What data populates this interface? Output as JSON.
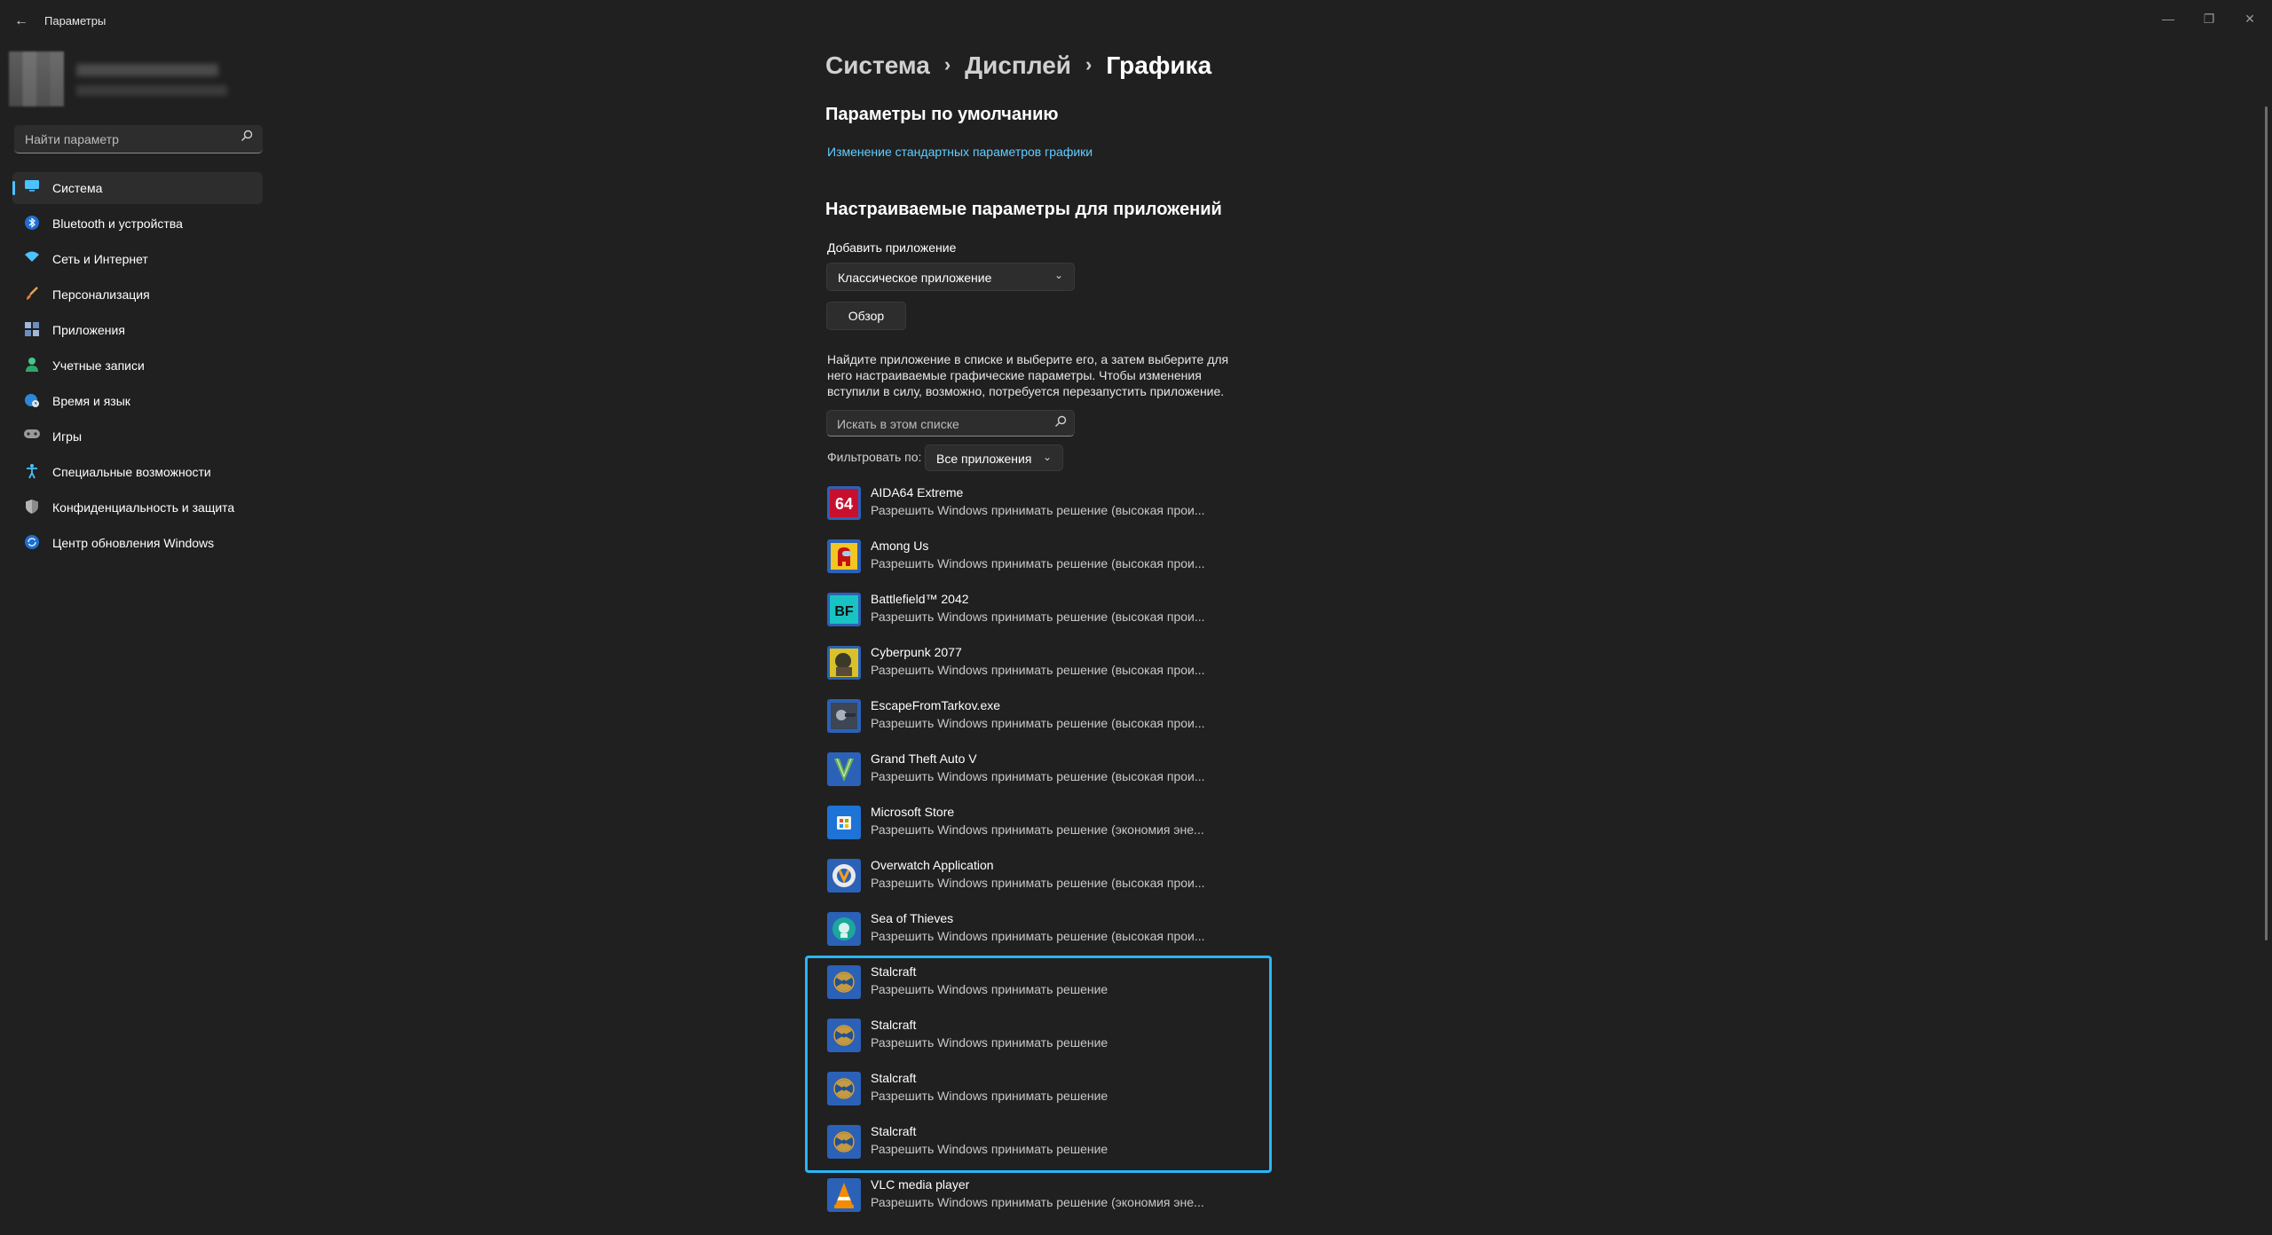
{
  "window": {
    "title": "Параметры",
    "controls": [
      "minimize",
      "restore",
      "close"
    ]
  },
  "sidebar": {
    "search": {
      "placeholder": "Найти параметр",
      "icon": "search-icon"
    },
    "items": [
      {
        "label": "Система",
        "icon": "monitor-icon",
        "color": "#4cc2ff",
        "active": true
      },
      {
        "label": "Bluetooth и устройства",
        "icon": "bluetooth-icon",
        "color": "#4cc2ff"
      },
      {
        "label": "Сеть и Интернет",
        "icon": "wifi-icon",
        "color": "#4cc2ff"
      },
      {
        "label": "Персонализация",
        "icon": "brush-icon",
        "color": "#f0a04b"
      },
      {
        "label": "Приложения",
        "icon": "apps-icon",
        "color": "#7fa6d9"
      },
      {
        "label": "Учетные записи",
        "icon": "person-icon",
        "color": "#42c88a"
      },
      {
        "label": "Время и язык",
        "icon": "globe-clock-icon",
        "color": "#4cc2ff"
      },
      {
        "label": "Игры",
        "icon": "gamepad-icon",
        "color": "#bdbdbd"
      },
      {
        "label": "Специальные возможности",
        "icon": "accessibility-icon",
        "color": "#4cc2ff"
      },
      {
        "label": "Конфиденциальность и защита",
        "icon": "shield-icon",
        "color": "#9a9a9a"
      },
      {
        "label": "Центр обновления Windows",
        "icon": "update-icon",
        "color": "#4cc2ff"
      }
    ]
  },
  "breadcrumb": {
    "items": [
      "Система",
      "Дисплей"
    ],
    "current": "Графика",
    "separator": "›"
  },
  "defaults": {
    "heading": "Параметры по умолчанию",
    "link": "Изменение стандартных параметров графики"
  },
  "custom": {
    "heading": "Настраиваемые параметры для приложений",
    "add_label": "Добавить приложение",
    "app_type": "Классическое приложение",
    "browse_button": "Обзор",
    "description": "Найдите приложение в списке и выберите его, а затем выберите для него настраиваемые графические параметры. Чтобы изменения вступили в силу, возможно, потребуется перезапустить приложение.",
    "list_search_placeholder": "Искать в этом списке",
    "filter_label": "Фильтровать по:",
    "filter_value": "Все приложения"
  },
  "apps": [
    {
      "name": "AIDA64 Extreme",
      "setting": "Разрешить Windows принимать решение (высокая прои...",
      "icon": "aida64-icon"
    },
    {
      "name": "Among Us",
      "setting": "Разрешить Windows принимать решение (высокая прои...",
      "icon": "among-us-icon"
    },
    {
      "name": "Battlefield™ 2042",
      "setting": "Разрешить Windows принимать решение (высокая прои...",
      "icon": "battlefield-icon"
    },
    {
      "name": "Cyberpunk 2077",
      "setting": "Разрешить Windows принимать решение (высокая прои...",
      "icon": "cyberpunk-icon"
    },
    {
      "name": "EscapeFromTarkov.exe",
      "setting": "Разрешить Windows принимать решение (высокая прои...",
      "icon": "tarkov-icon"
    },
    {
      "name": "Grand Theft Auto V",
      "setting": "Разрешить Windows принимать решение (высокая прои...",
      "icon": "gta-icon"
    },
    {
      "name": "Microsoft Store",
      "setting": "Разрешить Windows принимать решение (экономия эне...",
      "icon": "store-icon"
    },
    {
      "name": "Overwatch Application",
      "setting": "Разрешить Windows принимать решение (высокая прои...",
      "icon": "overwatch-icon"
    },
    {
      "name": "Sea of Thieves",
      "setting": "Разрешить Windows принимать решение (высокая прои...",
      "icon": "sea-of-thieves-icon"
    },
    {
      "name": "Stalcraft",
      "setting": "Разрешить Windows принимать решение",
      "icon": "stalcraft-icon"
    },
    {
      "name": "Stalcraft",
      "setting": "Разрешить Windows принимать решение",
      "icon": "stalcraft-icon"
    },
    {
      "name": "Stalcraft",
      "setting": "Разрешить Windows принимать решение",
      "icon": "stalcraft-icon"
    },
    {
      "name": "Stalcraft",
      "setting": "Разрешить Windows принимать решение",
      "icon": "stalcraft-icon"
    },
    {
      "name": "VLC media player",
      "setting": "Разрешить Windows принимать решение (экономия эне...",
      "icon": "vlc-icon"
    }
  ],
  "colors": {
    "background": "#202020",
    "accent": "#4cc2ff",
    "link": "#60cdff",
    "highlight_border": "#29b6f6"
  }
}
